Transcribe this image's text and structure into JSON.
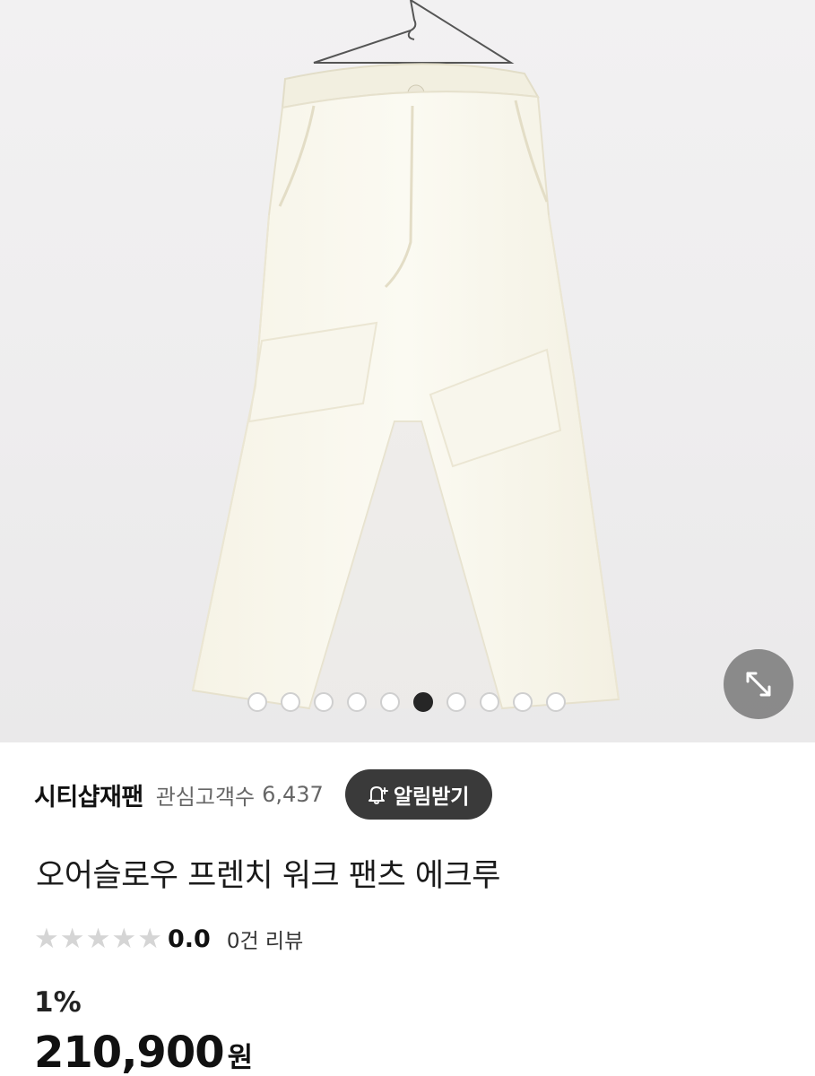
{
  "gallery": {
    "total_images": 10,
    "current_index": 6,
    "expand_icon": "expand-arrows-icon"
  },
  "store": {
    "name": "시티샵재팬",
    "interest_label": "관심고객수",
    "interest_count": "6,437",
    "alert_label": "알림받기",
    "alert_icon": "bell-plus-icon"
  },
  "product": {
    "title": "오어슬로우 프렌치 워크 팬츠 에크루",
    "rating": "0.0",
    "rating_stars": 0,
    "review_count_label": "0건 리뷰",
    "discount": "1%",
    "price": "210,900",
    "currency": "원"
  },
  "colors": {
    "alert_button_bg": "#3a3a3a",
    "active_dot": "#262626",
    "star_empty": "#d5d5d5"
  }
}
